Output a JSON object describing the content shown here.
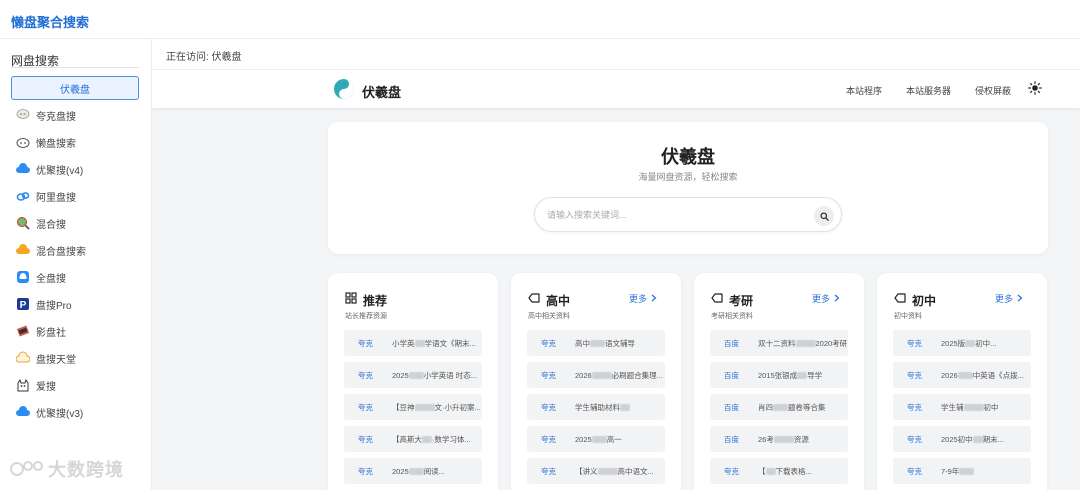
{
  "app": {
    "title": "懒盘聚合搜索"
  },
  "sidebar": {
    "heading": "网盘搜索",
    "items": [
      {
        "label": "伏羲盘",
        "icon": "taiji-icon",
        "active": true
      },
      {
        "label": "夸克盘搜",
        "icon": "chat-bubble-icon"
      },
      {
        "label": "懒盘搜索",
        "icon": "cloud-face-icon"
      },
      {
        "label": "优聚搜(v4)",
        "icon": "blue-cloud-icon"
      },
      {
        "label": "阿里盘搜",
        "icon": "aliyun-icon"
      },
      {
        "label": "混合搜",
        "icon": "magnifier-globe-icon"
      },
      {
        "label": "混合盘搜索",
        "icon": "orange-cloud-icon"
      },
      {
        "label": "全盘搜",
        "icon": "blue-box-icon"
      },
      {
        "label": "盘搜Pro",
        "icon": "p-badge-icon"
      },
      {
        "label": "影盘社",
        "icon": "film-icon"
      },
      {
        "label": "盘搜天堂",
        "icon": "cloud-outline-icon"
      },
      {
        "label": "爱搜",
        "icon": "cat-icon"
      },
      {
        "label": "优聚搜(v3)",
        "icon": "blue-cloud-icon"
      }
    ]
  },
  "breadcrumb": {
    "text": "正在访问: 伏羲盘"
  },
  "site": {
    "name": "伏羲盘",
    "nav": [
      "本站程序",
      "本站服务器",
      "侵权屏蔽"
    ],
    "hero_title": "伏羲盘",
    "hero_subtitle": "海量网盘资源，轻松搜索",
    "search_placeholder": "请输入搜索关键词..."
  },
  "cards": [
    {
      "title": "推荐",
      "icon": "grid-icon",
      "subtitle": "站长推荐资源",
      "more": "",
      "rows": [
        {
          "tag": "夸克",
          "pre": "小学英",
          "post": "学语文《期末..."
        },
        {
          "tag": "夸克",
          "pre": "2025",
          "post": "小学英语 时态..."
        },
        {
          "tag": "夸克",
          "pre": "【豆神",
          "post": "文·小升初案..."
        },
        {
          "tag": "夸克",
          "pre": "【高斯大",
          "post": "·数学习体..."
        },
        {
          "tag": "夸克",
          "pre": "2025",
          "post": "阅读..."
        }
      ]
    },
    {
      "title": "高中",
      "icon": "tag-icon",
      "subtitle": "高中相关资料",
      "more": "更多",
      "rows": [
        {
          "tag": "夸克",
          "pre": "高中",
          "post": "语文辅导"
        },
        {
          "tag": "夸克",
          "pre": "2026",
          "post": "必刷题合集理..."
        },
        {
          "tag": "夸克",
          "pre": "学生辅助材料",
          "post": ""
        },
        {
          "tag": "夸克",
          "pre": "2025",
          "post": "高一"
        },
        {
          "tag": "夸克",
          "pre": "【讲义",
          "post": "高中语文..."
        }
      ]
    },
    {
      "title": "考研",
      "icon": "tag-icon",
      "subtitle": "考研相关资料",
      "more": "更多",
      "rows": [
        {
          "tag": "百度",
          "pre": "双十二资料",
          "post": "2020考研"
        },
        {
          "tag": "百度",
          "pre": "2015张银成",
          "post": "导学"
        },
        {
          "tag": "百度",
          "pre": "肖四",
          "post": "题卷等合集"
        },
        {
          "tag": "百度",
          "pre": "26考",
          "post": "资源"
        },
        {
          "tag": "夸克",
          "pre": "【",
          "post": "下载表格..."
        }
      ]
    },
    {
      "title": "初中",
      "icon": "tag-icon",
      "subtitle": "初中资料",
      "more": "更多",
      "rows": [
        {
          "tag": "夸克",
          "pre": "2025版",
          "post": "初中..."
        },
        {
          "tag": "夸克",
          "pre": "2026",
          "post": "中英语《点拨..."
        },
        {
          "tag": "夸克",
          "pre": "学生辅",
          "post": "初中"
        },
        {
          "tag": "夸克",
          "pre": "2025初中",
          "post": "期末..."
        },
        {
          "tag": "夸克",
          "pre": "7-9年",
          "post": ""
        }
      ]
    }
  ],
  "watermark": {
    "text": "大数跨境"
  },
  "colors": {
    "accent": "#1f6fd6",
    "link": "#2d72d9",
    "active_bg": "#eaf3ff"
  }
}
